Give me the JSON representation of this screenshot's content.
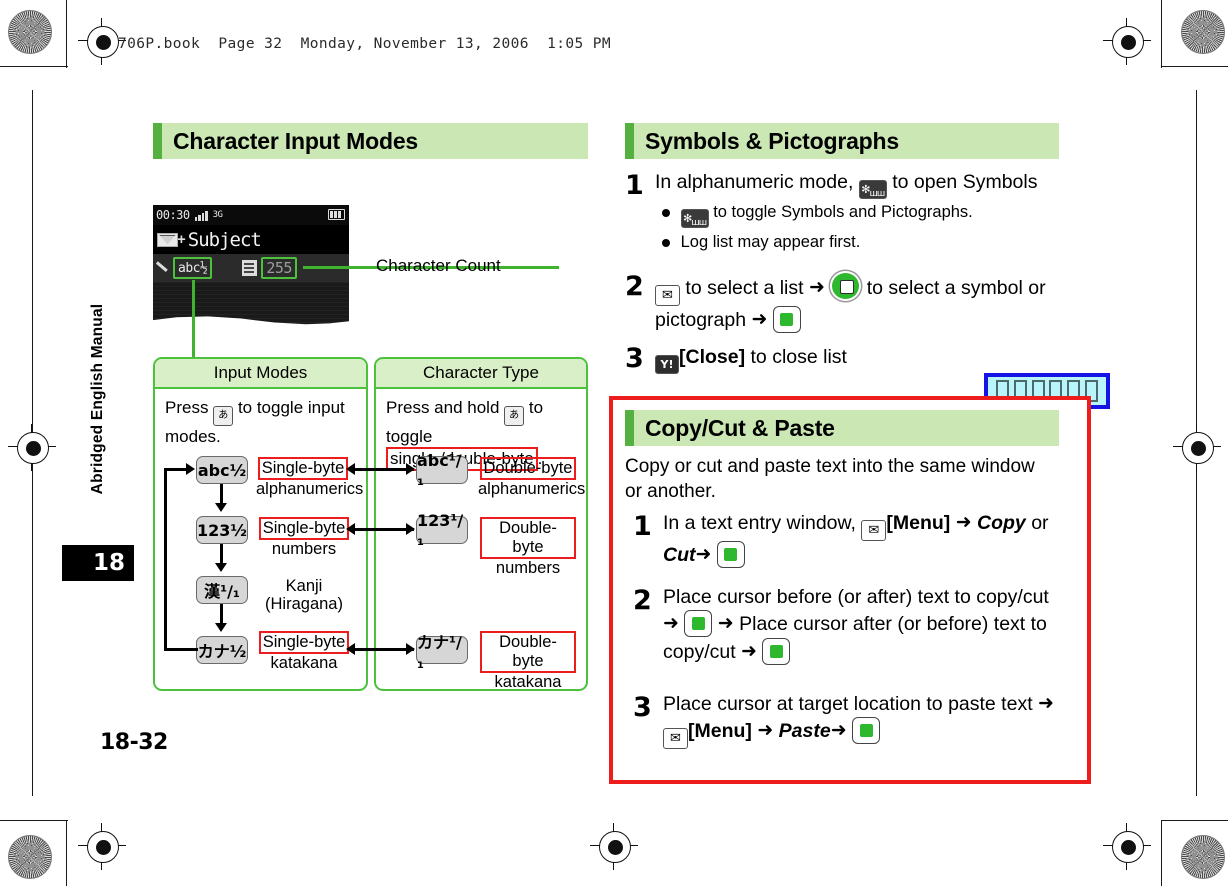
{
  "page": {
    "running_header": "706P.book  Page 32  Monday, November 13, 2006  1:05 PM",
    "spine_title": "Abridged English Manual",
    "chapter_number": "18",
    "folio": "18-32"
  },
  "left_column": {
    "section_title": "Character Input Modes",
    "phone_screen": {
      "status_time": "00:30",
      "network": "3G",
      "subject_label": "Subject",
      "input_mode_indicator": "abc½",
      "character_count": "255"
    },
    "callout": {
      "label": "Character Count"
    },
    "panels": [
      {
        "title": "Input Modes",
        "body_prefix": "Press",
        "body_suffix": "to toggle input modes.",
        "key_icon": "character-mode-key"
      },
      {
        "title": "Character Type",
        "body_prefix": "Press and hold",
        "body_mid": "to toggle",
        "body_boxed": "single-/double-byte",
        "body_end": ".",
        "key_icon": "character-mode-key"
      }
    ],
    "flow": {
      "single_column": [
        {
          "key": "abc½",
          "boxed": "Single-byte",
          "sub": "alphanumerics"
        },
        {
          "key": "123½",
          "boxed": "Single-byte",
          "sub": "numbers"
        },
        {
          "key": "漢¹/₁",
          "boxed": "",
          "sub": "Kanji\n(Hiragana)"
        },
        {
          "key": "カナ½",
          "boxed": "Single-byte",
          "sub": "katakana"
        }
      ],
      "double_column": [
        {
          "key": "abc¹/₁",
          "boxed": "Double-byte",
          "sub": "alphanumerics"
        },
        {
          "key": "123¹/₁",
          "boxed": "Double-byte",
          "sub": "numbers"
        },
        {
          "key": "カナ¹/₁",
          "boxed": "Double-byte",
          "sub": "katakana"
        }
      ]
    }
  },
  "right_column": {
    "symbols_section": {
      "title": "Symbols & Pictographs",
      "steps": [
        {
          "num": "1",
          "text_a": "In alphanumeric mode,",
          "icon": "star-key",
          "text_b": "to open Symbols",
          "bullets": [
            {
              "icon": "star-key",
              "text": "to toggle Symbols and Pictographs."
            },
            {
              "icon": "",
              "text": "Log list may appear first."
            }
          ]
        },
        {
          "num": "2",
          "text_a": "to select a list",
          "text_b": "to select a symbol or pictograph",
          "icons": [
            "mail-key",
            "nav-ring-key",
            "nav-center-key"
          ]
        },
        {
          "num": "3",
          "bold_label": "[Close]",
          "text_b": "to close list",
          "icon": "softkey-y"
        }
      ]
    },
    "tofu_box": {
      "glyph_count": 6,
      "note": "unrendered-characters"
    },
    "copypaste_section": {
      "title": "Copy/Cut & Paste",
      "intro": "Copy or cut and paste text into the same window or another.",
      "steps": [
        {
          "num": "1",
          "text_a": "In a text entry window,",
          "menu_label": "[Menu]",
          "italic_a": "Copy",
          "text_b": "or",
          "italic_b": "Cut"
        },
        {
          "num": "2",
          "text_a": "Place cursor before (or after) text to copy/cut",
          "text_b": "Place cursor after (or before) text to copy/cut"
        },
        {
          "num": "3",
          "text_a": "Place cursor at target location to paste text",
          "menu_label": "[Menu]",
          "italic_a": "Paste"
        }
      ]
    }
  },
  "colors": {
    "heading_bg": "#cbe7b4",
    "heading_bar": "#55b13f",
    "panel_border": "#4cc23c",
    "panel_head_bg": "#d9efc7",
    "red_highlight": "#ee1d1d",
    "tofu_bg": "#b7f5fb",
    "tofu_border": "#1414e6",
    "accent_green": "#2eb82e"
  }
}
